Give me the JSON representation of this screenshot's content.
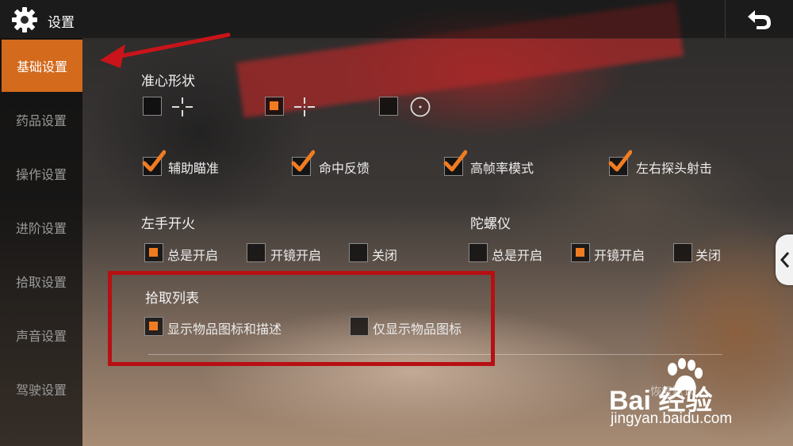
{
  "header": {
    "title": "设置",
    "settings_icon": "gear-icon",
    "back_icon": "back-arrow-icon"
  },
  "sidebar": {
    "items": [
      {
        "label": "基础设置",
        "active": true
      },
      {
        "label": "药品设置",
        "active": false
      },
      {
        "label": "操作设置",
        "active": false
      },
      {
        "label": "进阶设置",
        "active": false
      },
      {
        "label": "拾取设置",
        "active": false
      },
      {
        "label": "声音设置",
        "active": false
      },
      {
        "label": "驾驶设置",
        "active": false
      }
    ]
  },
  "crosshair": {
    "title": "准心形状",
    "options": [
      {
        "icon": "crosshair-cross-icon",
        "checked": false
      },
      {
        "icon": "crosshair-cross-dot-icon",
        "checked": true
      },
      {
        "icon": "crosshair-circle-dot-icon",
        "checked": false
      }
    ]
  },
  "toggles": [
    {
      "label": "辅助瞄准",
      "checked": true
    },
    {
      "label": "命中反馈",
      "checked": true
    },
    {
      "label": "高帧率模式",
      "checked": true
    },
    {
      "label": "左右探头射击",
      "checked": true
    }
  ],
  "left_fire": {
    "title": "左手开火",
    "options": [
      {
        "label": "总是开启",
        "checked": true
      },
      {
        "label": "开镜开启",
        "checked": false
      },
      {
        "label": "关闭",
        "checked": false
      }
    ]
  },
  "gyroscope": {
    "title": "陀螺仪",
    "options": [
      {
        "label": "总是开启",
        "checked": false
      },
      {
        "label": "开镜开启",
        "checked": true
      },
      {
        "label": "关闭",
        "checked": false
      }
    ]
  },
  "pickup_list": {
    "title": "拾取列表",
    "options": [
      {
        "label": "显示物品图标和描述",
        "checked": true
      },
      {
        "label": "仅显示物品图标",
        "checked": false
      }
    ]
  },
  "colors": {
    "accent": "#f07c22",
    "active_tab": "#d36a1c",
    "annotation_red": "#b71013"
  },
  "watermark": {
    "logo": "Bai 经验",
    "url": "jingyan.baidu.com",
    "faded_text": "恢复默认"
  }
}
